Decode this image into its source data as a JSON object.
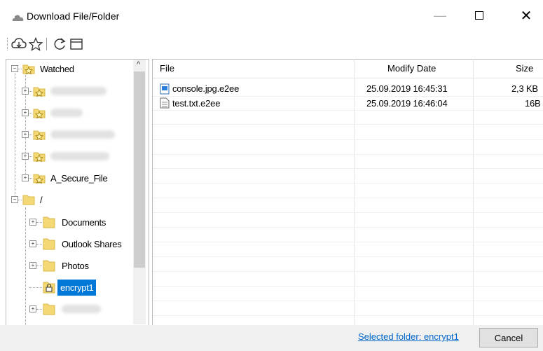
{
  "window": {
    "title": "Download File/Folder",
    "min_glyph": "—",
    "max_glyph": "☐",
    "close_glyph": "✕"
  },
  "toolbar": {
    "icons": [
      "download-cloud-icon",
      "star-outline-icon",
      "refresh-icon",
      "window-icon"
    ]
  },
  "tree": {
    "watched_label": "Watched",
    "watched_items": [
      "",
      "",
      "",
      "",
      "A_Secure_File"
    ],
    "root_label": "/",
    "root_items": [
      "Documents",
      "Outlook Shares",
      "Photos",
      "encrypt1",
      ""
    ],
    "selected_item": "encrypt1",
    "scroll_up_glyph": "^"
  },
  "file_list": {
    "columns": [
      "File",
      "Modify Date",
      "Size"
    ],
    "rows": [
      {
        "name": "console.jpg.e2ee",
        "date": "25.09.2019 16:45:31",
        "size": "2,3 KB",
        "icon": "image-file-icon"
      },
      {
        "name": "test.txt.e2ee",
        "date": "25.09.2019 16:46:04",
        "size": "16B",
        "icon": "text-file-icon"
      }
    ]
  },
  "footer": {
    "selected_folder_text": "Selected folder: encrypt1",
    "cancel_label": "Cancel"
  },
  "colors": {
    "folder": "#f5d876",
    "selection": "#0078d7",
    "link": "#0066cc",
    "star": "#c9a300"
  }
}
